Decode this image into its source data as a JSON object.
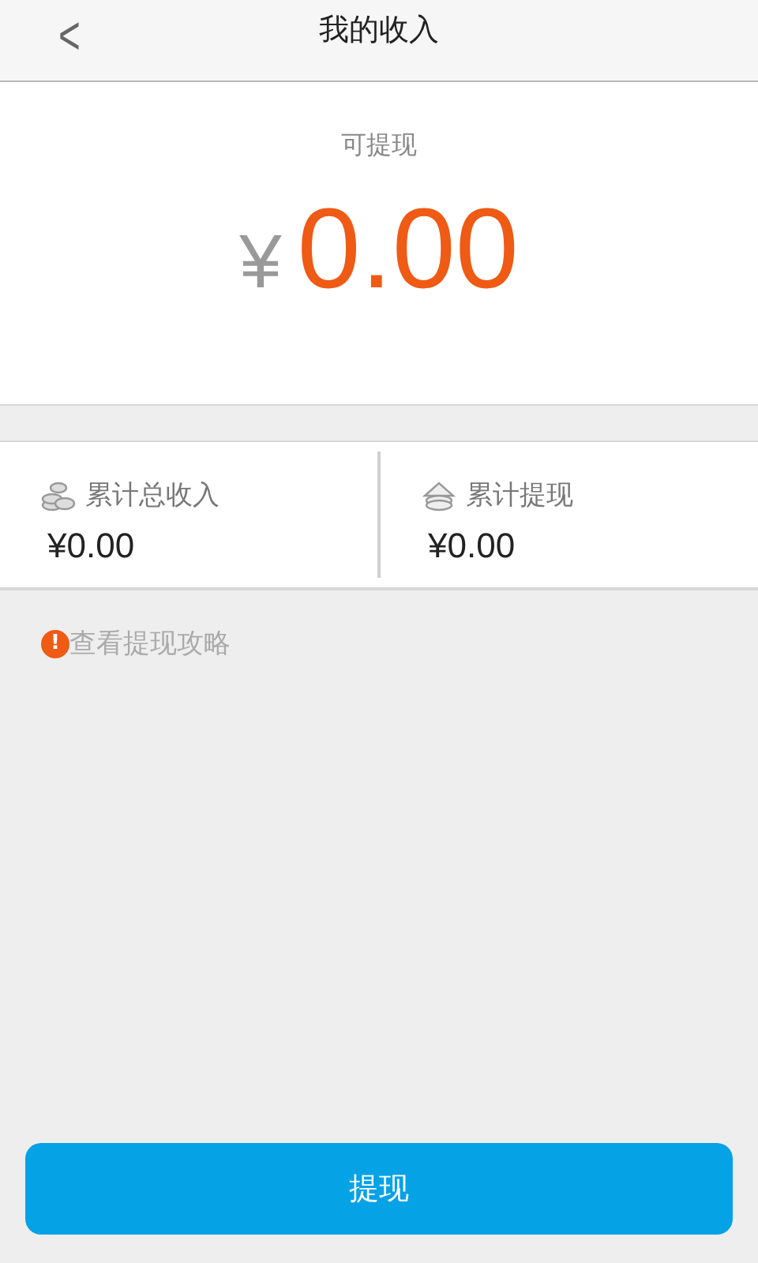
{
  "header": {
    "back": "<",
    "title": "我的收入"
  },
  "balance": {
    "label": "可提现",
    "currency": "¥",
    "amount": "0.00"
  },
  "stats": [
    {
      "kind": "income",
      "label": "累计总收入",
      "value": "¥0.00"
    },
    {
      "kind": "withdrawn",
      "label": "累计提现",
      "value": "¥0.00"
    }
  ],
  "guide": {
    "icon": "!",
    "text": "查看提现攻略"
  },
  "button": "提现"
}
